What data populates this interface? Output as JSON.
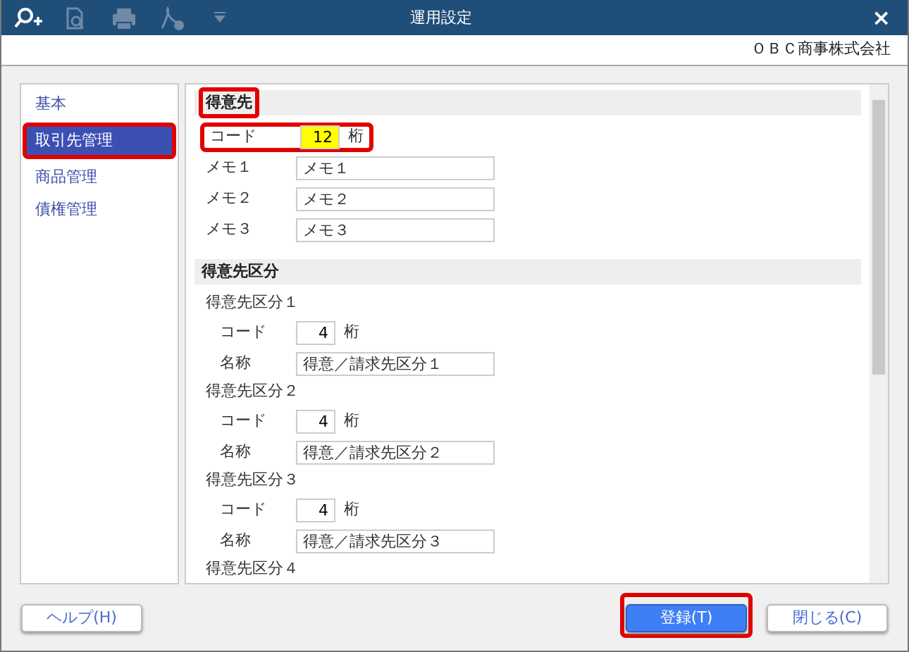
{
  "window": {
    "title": "運用設定",
    "company": "ＯＢＣ商事株式会社"
  },
  "toolbar": [
    {
      "kind": "zoom",
      "disabled": false
    },
    {
      "kind": "preview",
      "disabled": true
    },
    {
      "kind": "print",
      "disabled": true
    },
    {
      "kind": "pdf",
      "disabled": true
    },
    {
      "kind": "dropdown",
      "disabled": true
    }
  ],
  "close": "×",
  "sidebar": {
    "items": [
      {
        "label": "基本",
        "selected": false,
        "highlighted": false
      },
      {
        "label": "取引先管理",
        "selected": true,
        "highlighted": true
      },
      {
        "label": "商品管理",
        "selected": false,
        "highlighted": false
      },
      {
        "label": "債権管理",
        "selected": false,
        "highlighted": false
      }
    ]
  },
  "sections": [
    {
      "title": "得意先",
      "highlighted": true,
      "rows": [
        {
          "kind": "digits",
          "label": "コード",
          "value": "12",
          "unit": "桁",
          "emphasized": true,
          "highlighted": true
        },
        {
          "kind": "text",
          "label": "メモ１",
          "value": "メモ１"
        },
        {
          "kind": "text",
          "label": "メモ２",
          "value": "メモ２"
        },
        {
          "kind": "text",
          "label": "メモ３",
          "value": "メモ３"
        }
      ]
    },
    {
      "title": "得意先区分",
      "highlighted": false,
      "rows": [
        {
          "kind": "group",
          "label": "得意先区分１"
        },
        {
          "kind": "digits",
          "label": "コード",
          "value": "4",
          "unit": "桁",
          "emphasized": false,
          "highlighted": false,
          "indent": true
        },
        {
          "kind": "text",
          "label": "名称",
          "value": "得意／請求先区分１",
          "indent": true
        },
        {
          "kind": "group",
          "label": "得意先区分２"
        },
        {
          "kind": "digits",
          "label": "コード",
          "value": "4",
          "unit": "桁",
          "emphasized": false,
          "highlighted": false,
          "indent": true
        },
        {
          "kind": "text",
          "label": "名称",
          "value": "得意／請求先区分２",
          "indent": true
        },
        {
          "kind": "group",
          "label": "得意先区分３"
        },
        {
          "kind": "digits",
          "label": "コード",
          "value": "4",
          "unit": "桁",
          "emphasized": false,
          "highlighted": false,
          "indent": true
        },
        {
          "kind": "text",
          "label": "名称",
          "value": "得意／請求先区分３",
          "indent": true
        },
        {
          "kind": "group",
          "label": "得意先区分４"
        }
      ]
    }
  ],
  "buttons": [
    {
      "label": "ヘルプ(H)",
      "primary": false,
      "highlighted": false
    },
    {
      "label": "登録(T)",
      "primary": true,
      "highlighted": true
    },
    {
      "label": "閉じる(C)",
      "primary": false,
      "highlighted": false
    }
  ]
}
